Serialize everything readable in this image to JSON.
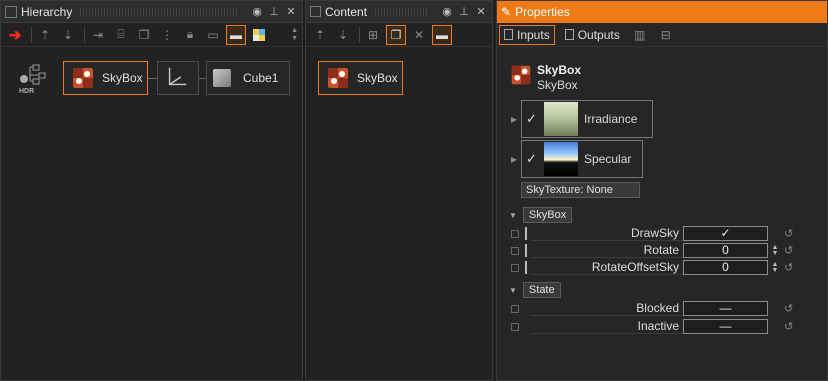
{
  "hierarchy": {
    "title": "Hierarchy",
    "nodes": [
      {
        "label": "SkyBox"
      },
      {
        "label": "Cube1"
      }
    ]
  },
  "content": {
    "title": "Content",
    "items": [
      {
        "label": "SkyBox"
      }
    ]
  },
  "properties": {
    "title": "Properties",
    "tabs": [
      {
        "label": "Inputs"
      },
      {
        "label": "Outputs"
      }
    ],
    "object_type": "SkyBox",
    "object_name": "SkyBox",
    "textures": [
      {
        "label": "Irradiance",
        "checked": "✓"
      },
      {
        "label": "Specular",
        "checked": "✓"
      }
    ],
    "sky_texture": "SkyTexture:  None",
    "sections": [
      {
        "label": "SkyBox",
        "rows": [
          {
            "name": "DrawSky",
            "value": "✓"
          },
          {
            "name": "Rotate",
            "value": "0"
          },
          {
            "name": "RotateOffsetSky",
            "value": "0"
          }
        ]
      },
      {
        "label": "State",
        "rows": [
          {
            "name": "Blocked",
            "value": "—"
          },
          {
            "name": "Inactive",
            "value": "—"
          }
        ]
      }
    ]
  },
  "colors": {
    "accent": "#f07a17",
    "red_arrow": "#ff2b1a"
  }
}
